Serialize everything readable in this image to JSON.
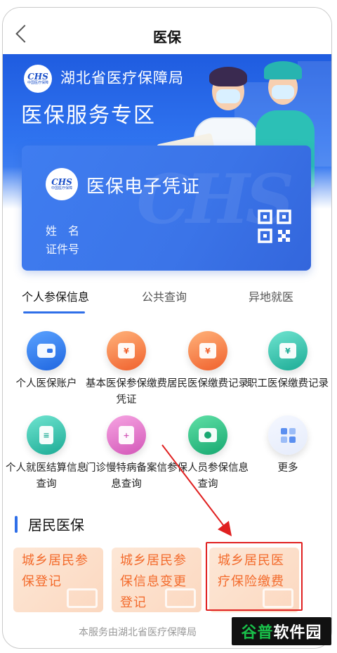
{
  "header": {
    "title": "医保",
    "back_icon": "chevron-left-icon"
  },
  "banner": {
    "bureau_name": "湖北省医疗保障局",
    "zone_title": "医保服务专区",
    "logo_text": "CHS",
    "logo_subtext": "中国医疗保障"
  },
  "card": {
    "title": "医保电子凭证",
    "name_label": "姓　名",
    "id_label": "证件号",
    "qr_icon": "qr-code-icon"
  },
  "tabs": [
    {
      "label": "个人参保信息",
      "active": true
    },
    {
      "label": "公共查询",
      "active": false
    },
    {
      "label": "异地就医",
      "active": false
    }
  ],
  "services": [
    {
      "label": "个人医保账户",
      "icon": "wallet-icon",
      "color": "#2f74e8"
    },
    {
      "label": "基本医保参保缴费凭证",
      "icon": "receipt-yen-icon",
      "color": "#f26a35"
    },
    {
      "label": "居民医保缴费记录",
      "icon": "receipt-yen-icon",
      "color": "#f26a35"
    },
    {
      "label": "职工医保缴费记录",
      "icon": "receipt-yen-icon",
      "color": "#22b49c"
    },
    {
      "label": "个人就医结算信息查询",
      "icon": "document-list-icon",
      "color": "#22b49c"
    },
    {
      "label": "门诊慢特病备案信息查询",
      "icon": "medical-card-icon",
      "color": "#d65cbb"
    },
    {
      "label": "参保人员参保信息查询",
      "icon": "user-card-icon",
      "color": "#1aab74"
    },
    {
      "label": "更多",
      "icon": "grid-more-icon",
      "color": "#5b8ff0"
    }
  ],
  "section": {
    "title": "居民医保",
    "tiles": [
      {
        "label": "城乡居民参保登记"
      },
      {
        "label": "城乡居民参保信息变更登记"
      },
      {
        "label": "城乡居民医疗保险缴费"
      }
    ]
  },
  "footer": {
    "note": "本服务由湖北省医疗保障局"
  },
  "watermark": {
    "part1": "谷普",
    "part2": "软件园"
  },
  "colors": {
    "primary_blue": "#2f6fe8",
    "tile_text": "#f36b2c",
    "annotation_red": "#e02020"
  }
}
